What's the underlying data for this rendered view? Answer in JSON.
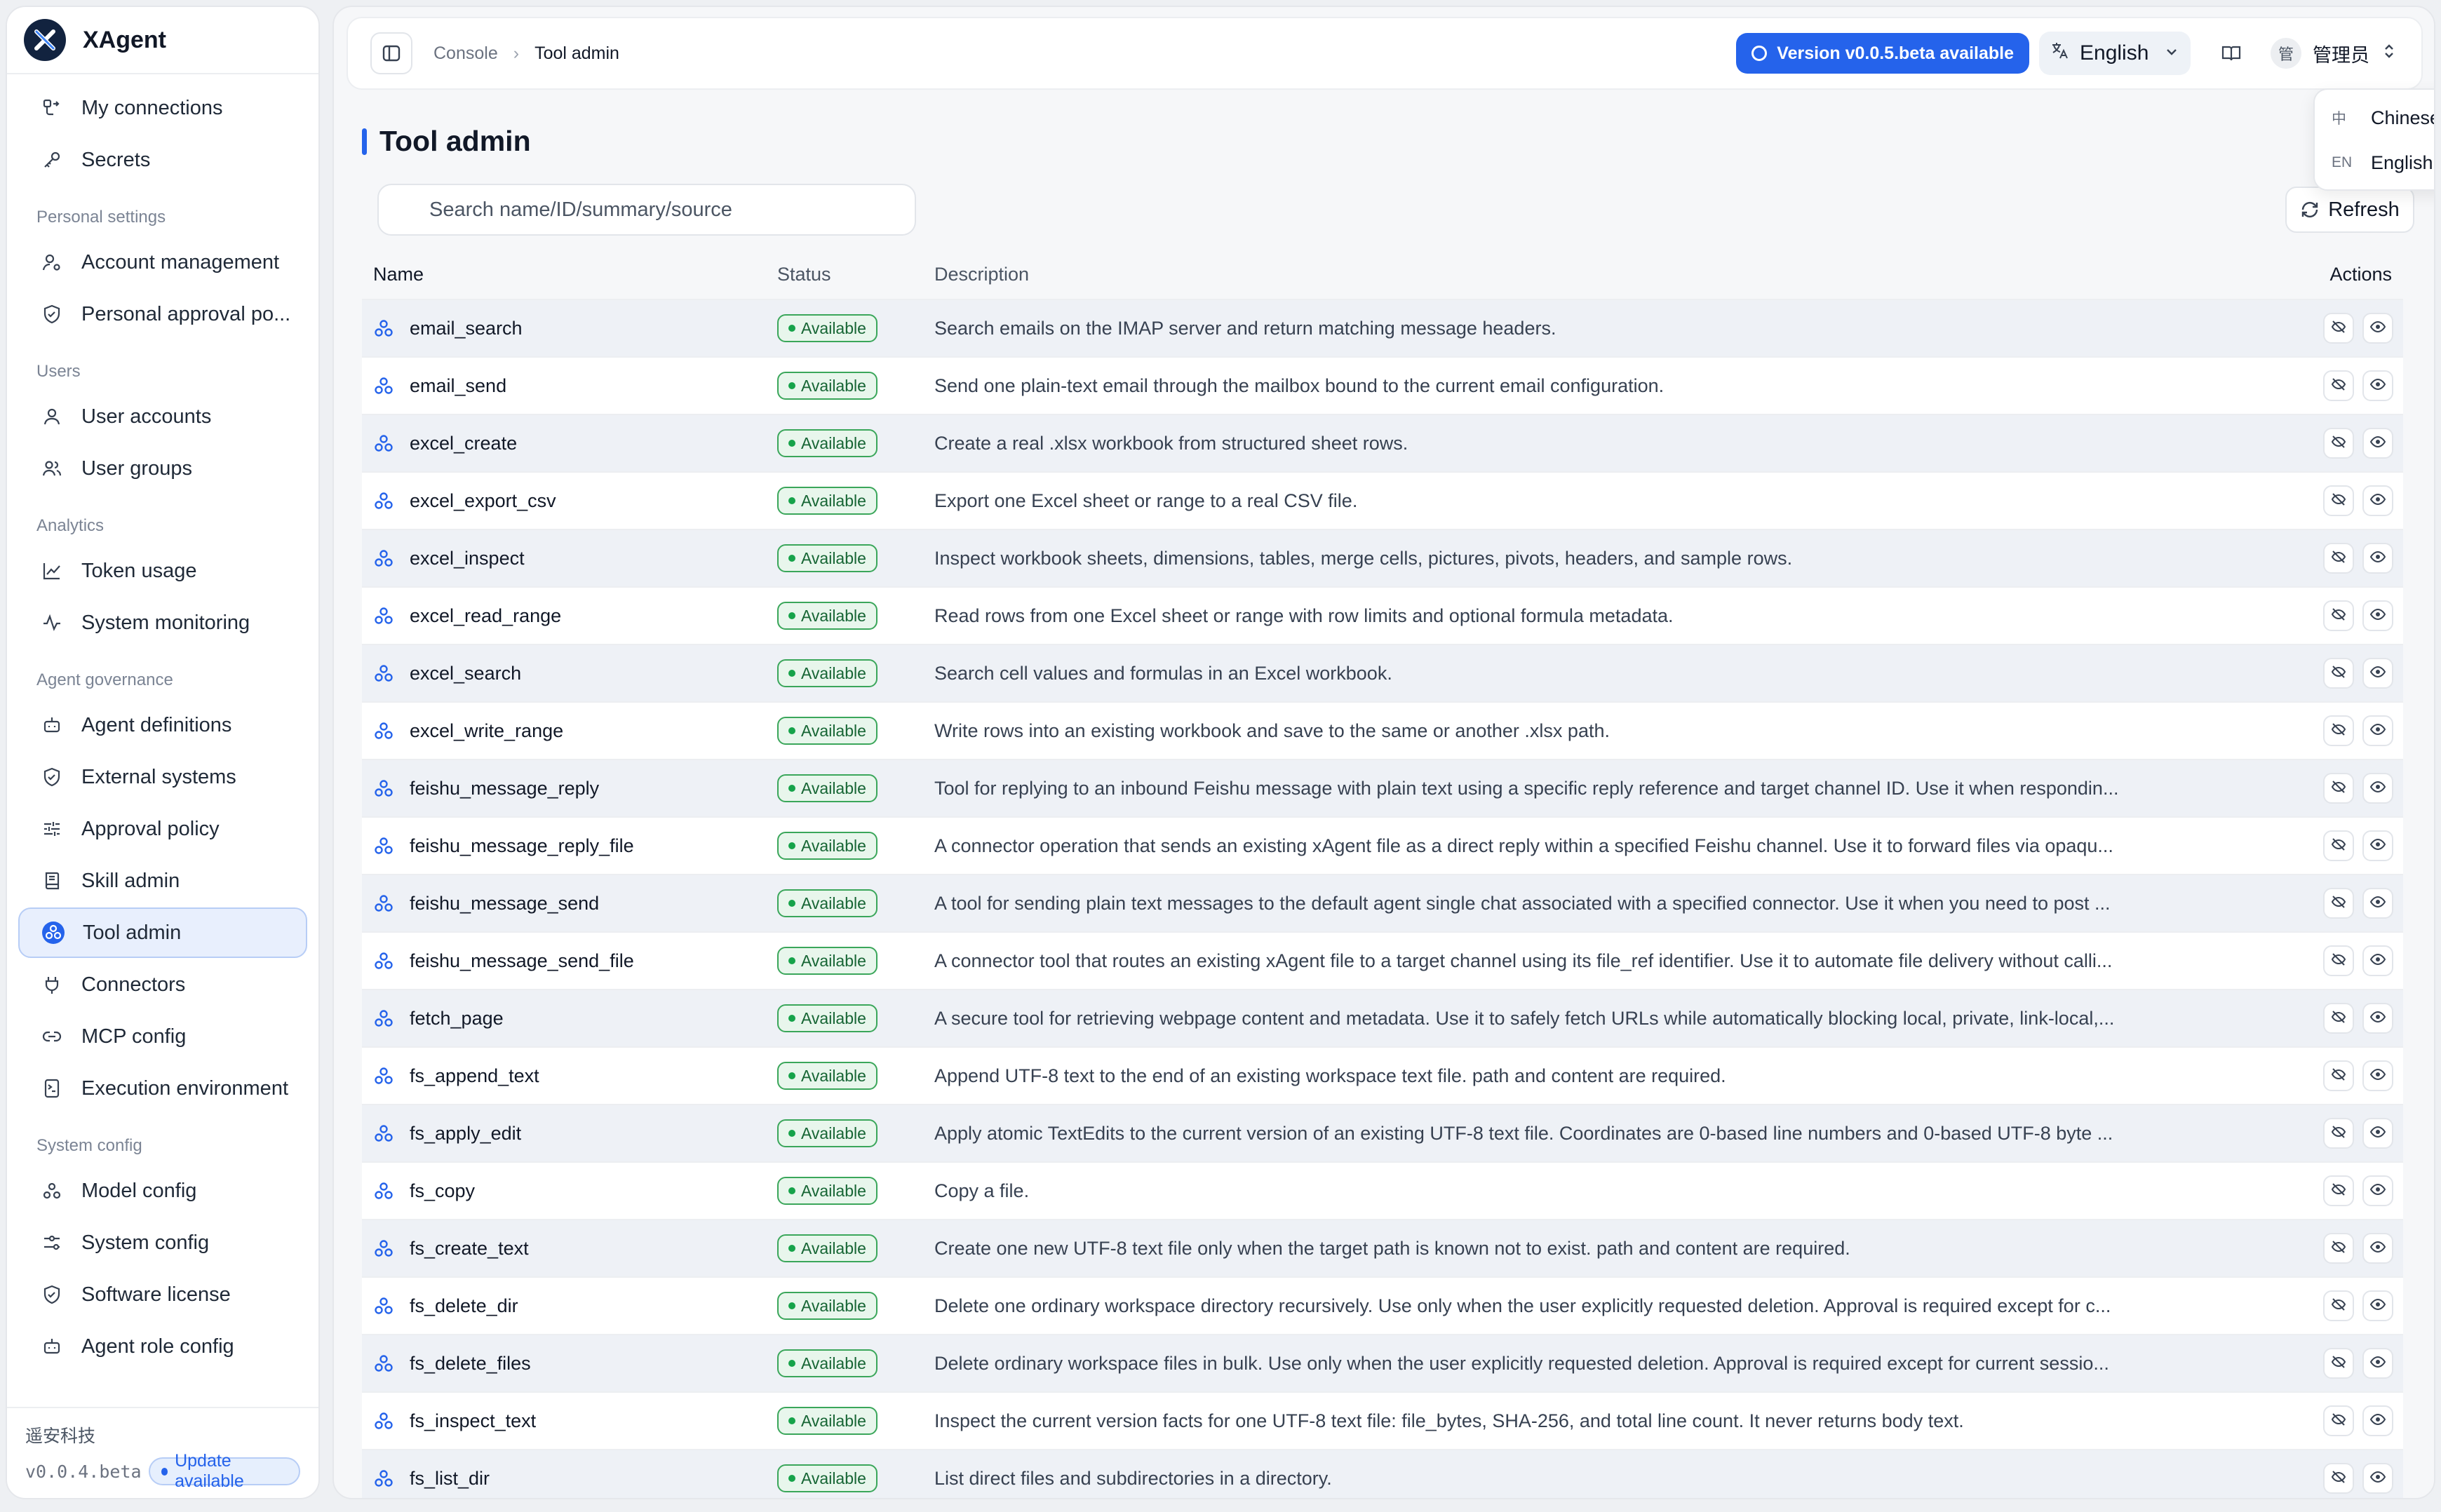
{
  "brand": {
    "name": "XAgent"
  },
  "sidebar": {
    "top_items": [
      {
        "label": "My connections",
        "icon": "connections-icon"
      },
      {
        "label": "Secrets",
        "icon": "key-icon"
      }
    ],
    "sections": [
      {
        "title": "Personal settings",
        "items": [
          {
            "label": "Account management",
            "icon": "user-gear-icon"
          },
          {
            "label": "Personal approval po...",
            "icon": "shield-icon"
          }
        ]
      },
      {
        "title": "Users",
        "items": [
          {
            "label": "User accounts",
            "icon": "user-icon"
          },
          {
            "label": "User groups",
            "icon": "users-icon"
          }
        ]
      },
      {
        "title": "Analytics",
        "items": [
          {
            "label": "Token usage",
            "icon": "chart-line-icon"
          },
          {
            "label": "System monitoring",
            "icon": "activity-icon"
          }
        ]
      },
      {
        "title": "Agent governance",
        "items": [
          {
            "label": "Agent definitions",
            "icon": "bot-icon"
          },
          {
            "label": "External systems",
            "icon": "shield-icon"
          },
          {
            "label": "Approval policy",
            "icon": "sliders-icon"
          },
          {
            "label": "Skill admin",
            "icon": "book-icon"
          },
          {
            "label": "Tool admin",
            "icon": "tool-icon",
            "active": true
          },
          {
            "label": "Connectors",
            "icon": "plug-icon"
          },
          {
            "label": "MCP config",
            "icon": "link-icon"
          },
          {
            "label": "Execution environment",
            "icon": "terminal-icon"
          }
        ]
      },
      {
        "title": "System config",
        "items": [
          {
            "label": "Model config",
            "icon": "model-icon"
          },
          {
            "label": "System config",
            "icon": "settings-icon"
          },
          {
            "label": "Software license",
            "icon": "shield-icon"
          },
          {
            "label": "Agent role config",
            "icon": "bot-icon"
          }
        ]
      }
    ],
    "footer": {
      "company": "遥安科技",
      "version": "v0.0.4.beta",
      "update_label": "Update available"
    }
  },
  "topbar": {
    "breadcrumb": [
      "Console",
      "Tool admin"
    ],
    "version_pill": "Version v0.0.5.beta available",
    "language": "English",
    "user": {
      "avatar": "管",
      "name": "管理员"
    }
  },
  "language_menu": [
    {
      "code": "中",
      "label": "Chinese",
      "selected": false
    },
    {
      "code": "EN",
      "label": "English",
      "selected": true
    }
  ],
  "page": {
    "title": "Tool admin",
    "search_placeholder": "Search name/ID/summary/source",
    "refresh_label": "Refresh"
  },
  "table": {
    "columns": {
      "name": "Name",
      "status": "Status",
      "description": "Description",
      "actions": "Actions"
    },
    "rows": [
      {
        "name": "email_search",
        "status": "Available",
        "description": "Search emails on the IMAP server and return matching message headers."
      },
      {
        "name": "email_send",
        "status": "Available",
        "description": "Send one plain-text email through the mailbox bound to the current email configuration."
      },
      {
        "name": "excel_create",
        "status": "Available",
        "description": "Create a real .xlsx workbook from structured sheet rows."
      },
      {
        "name": "excel_export_csv",
        "status": "Available",
        "description": "Export one Excel sheet or range to a real CSV file."
      },
      {
        "name": "excel_inspect",
        "status": "Available",
        "description": "Inspect workbook sheets, dimensions, tables, merge cells, pictures, pivots, headers, and sample rows."
      },
      {
        "name": "excel_read_range",
        "status": "Available",
        "description": "Read rows from one Excel sheet or range with row limits and optional formula metadata."
      },
      {
        "name": "excel_search",
        "status": "Available",
        "description": "Search cell values and formulas in an Excel workbook."
      },
      {
        "name": "excel_write_range",
        "status": "Available",
        "description": "Write rows into an existing workbook and save to the same or another .xlsx path."
      },
      {
        "name": "feishu_message_reply",
        "status": "Available",
        "description": "Tool for replying to an inbound Feishu message with plain text using a specific reply reference and target channel ID. Use it when respondin..."
      },
      {
        "name": "feishu_message_reply_file",
        "status": "Available",
        "description": "A connector operation that sends an existing xAgent file as a direct reply within a specified Feishu channel. Use it to forward files via opaqu..."
      },
      {
        "name": "feishu_message_send",
        "status": "Available",
        "description": "A tool for sending plain text messages to the default agent single chat associated with a specified connector. Use it when you need to post ..."
      },
      {
        "name": "feishu_message_send_file",
        "status": "Available",
        "description": "A connector tool that routes an existing xAgent file to a target channel using its file_ref identifier. Use it to automate file delivery without calli..."
      },
      {
        "name": "fetch_page",
        "status": "Available",
        "description": "A secure tool for retrieving webpage content and metadata. Use it to safely fetch URLs while automatically blocking local, private, link-local,..."
      },
      {
        "name": "fs_append_text",
        "status": "Available",
        "description": "Append UTF-8 text to the end of an existing workspace text file. path and content are required."
      },
      {
        "name": "fs_apply_edit",
        "status": "Available",
        "description": "Apply atomic TextEdits to the current version of an existing UTF-8 text file. Coordinates are 0-based line numbers and 0-based UTF-8 byte ..."
      },
      {
        "name": "fs_copy",
        "status": "Available",
        "description": "Copy a file."
      },
      {
        "name": "fs_create_text",
        "status": "Available",
        "description": "Create one new UTF-8 text file only when the target path is known not to exist. path and content are required."
      },
      {
        "name": "fs_delete_dir",
        "status": "Available",
        "description": "Delete one ordinary workspace directory recursively. Use only when the user explicitly requested deletion. Approval is required except for c..."
      },
      {
        "name": "fs_delete_files",
        "status": "Available",
        "description": "Delete ordinary workspace files in bulk. Use only when the user explicitly requested deletion. Approval is required except for current sessio..."
      },
      {
        "name": "fs_inspect_text",
        "status": "Available",
        "description": "Inspect the current version facts for one UTF-8 text file: file_bytes, SHA-256, and total line count. It never returns body text."
      },
      {
        "name": "fs_list_dir",
        "status": "Available",
        "description": "List direct files and subdirectories in a directory."
      }
    ]
  }
}
